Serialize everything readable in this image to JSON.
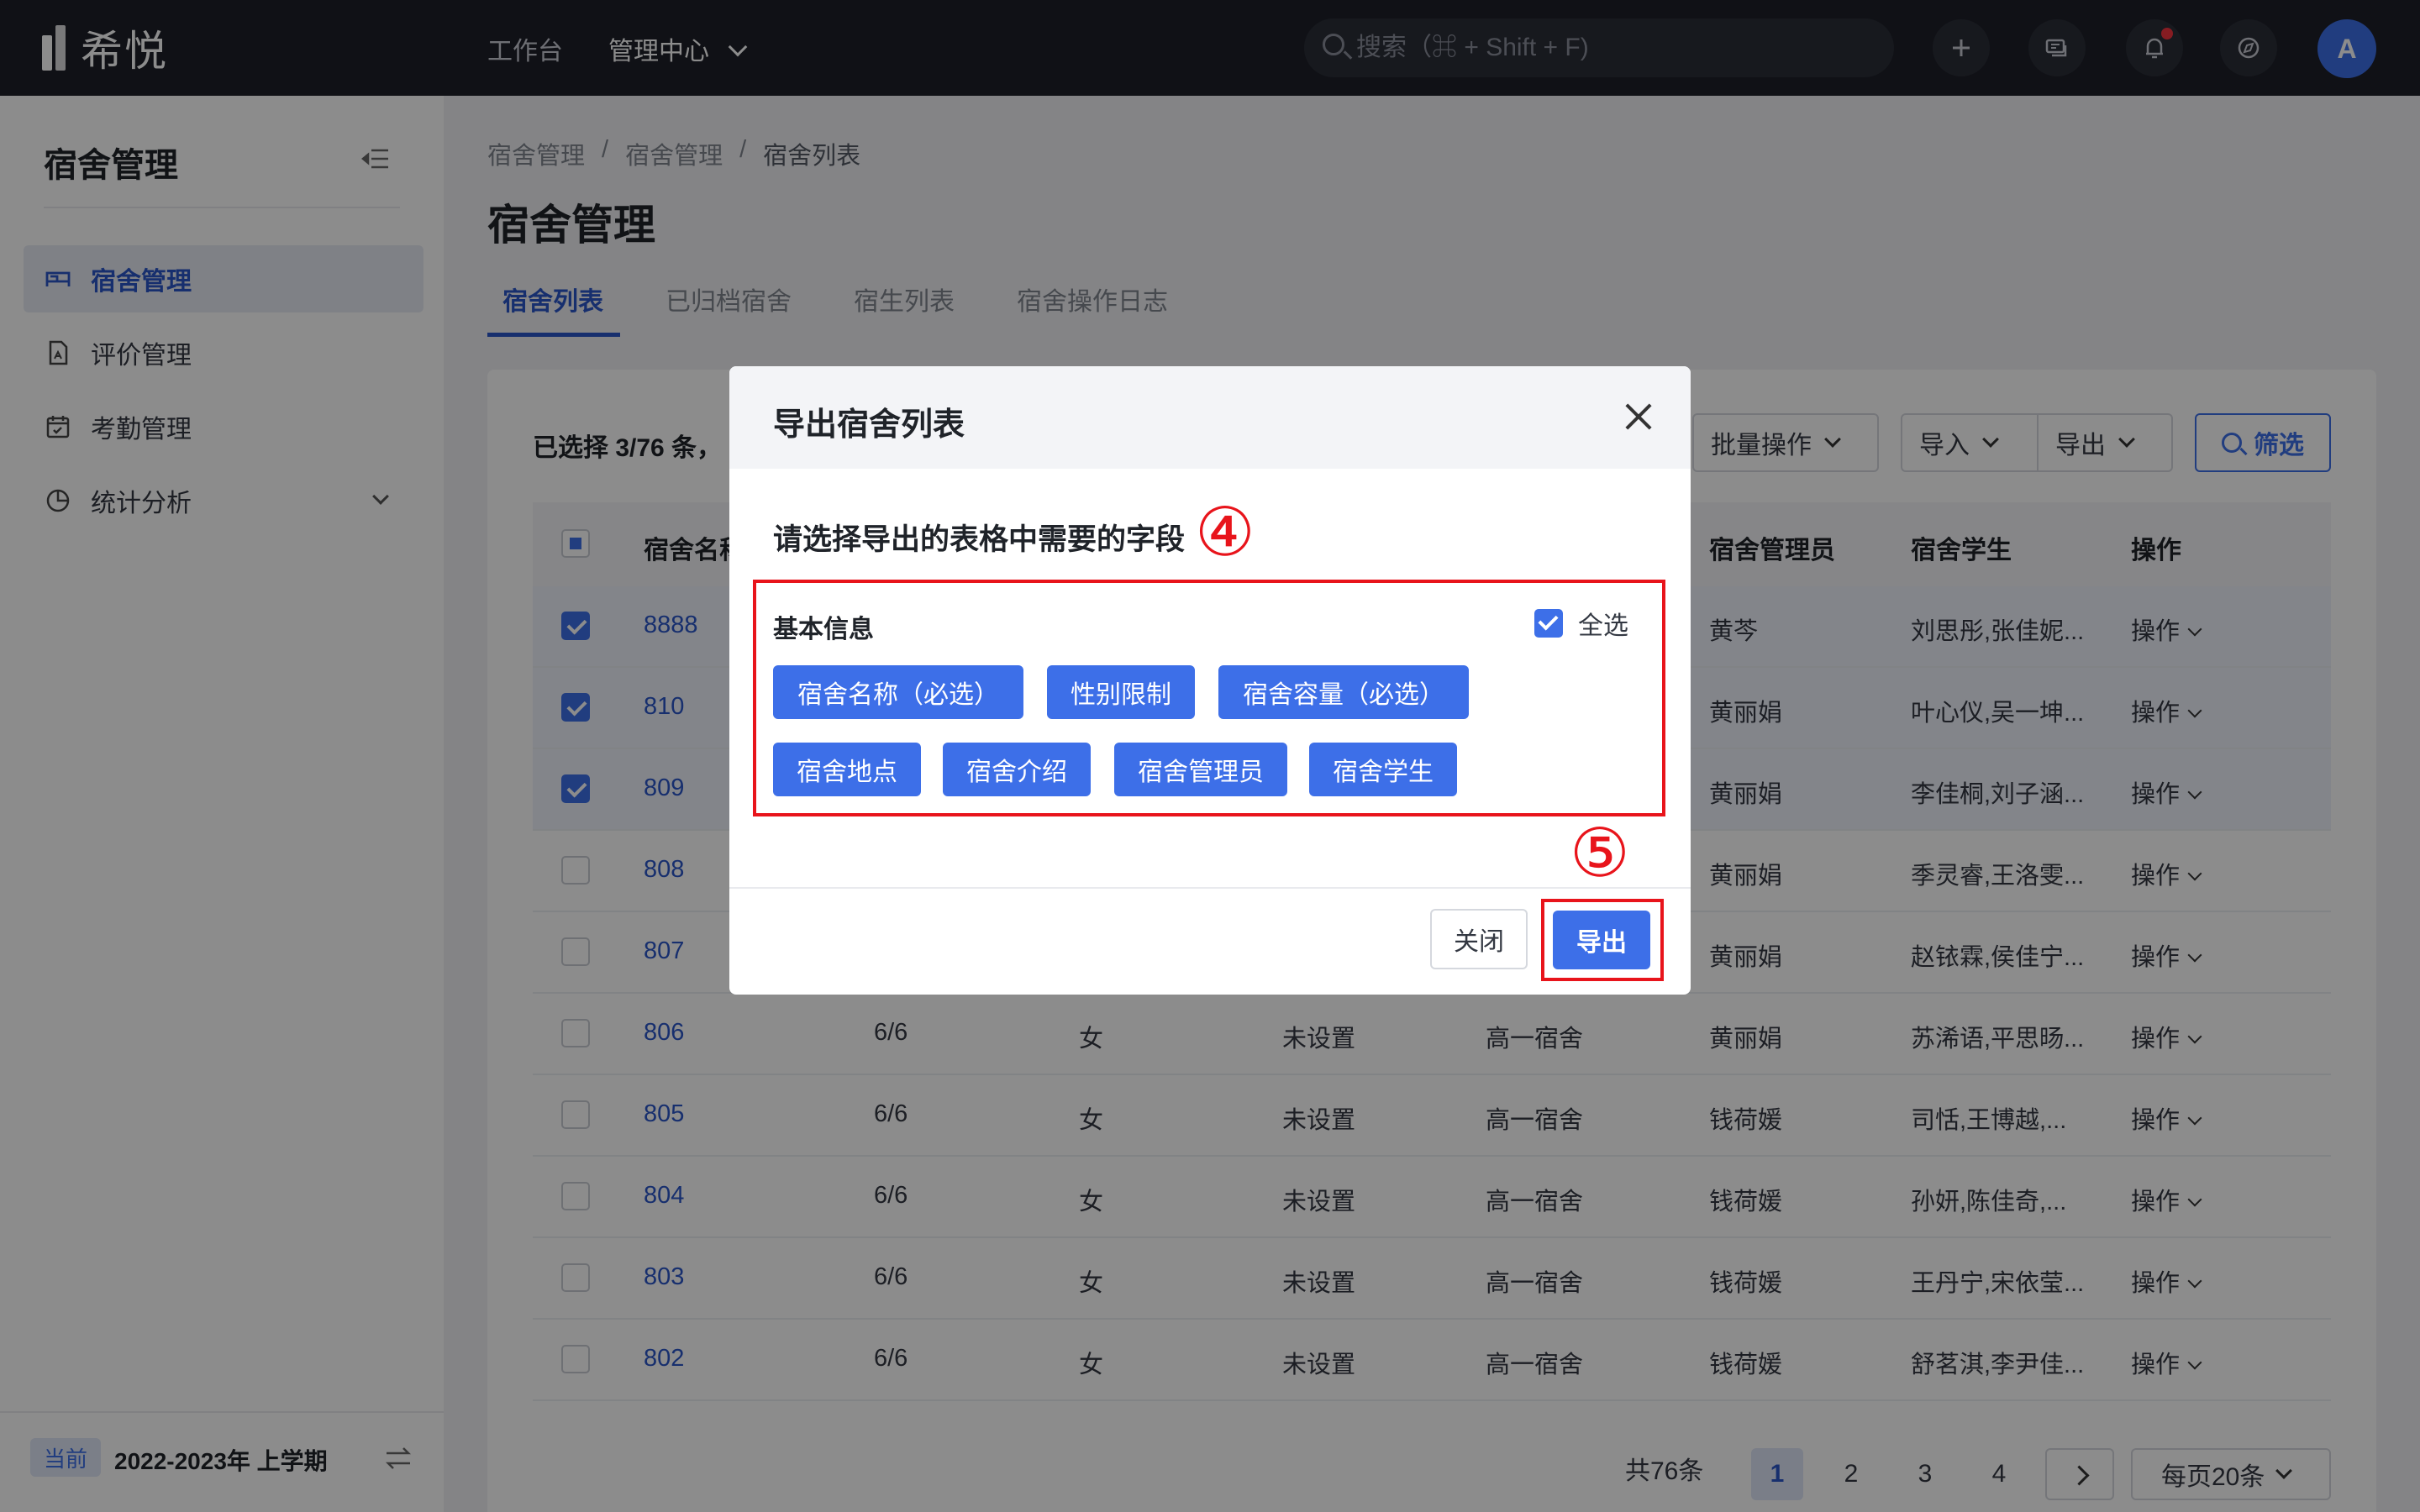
{
  "app": {
    "logo_text": "希悦"
  },
  "topnav": {
    "items": [
      "工作台",
      "管理中心"
    ]
  },
  "search": {
    "placeholder": "搜索（⌘ + Shift + F)"
  },
  "user": {
    "avatar_letter": "A"
  },
  "sidebar": {
    "title": "宿舍管理",
    "items": [
      {
        "label": "宿舍管理",
        "icon": "bed-icon",
        "active": true
      },
      {
        "label": "评价管理",
        "icon": "document-icon",
        "active": false
      },
      {
        "label": "考勤管理",
        "icon": "calendar-icon",
        "active": false
      },
      {
        "label": "统计分析",
        "icon": "pie-chart-icon",
        "active": false
      }
    ],
    "term_badge": "当前",
    "term_text": "2022-2023年 上学期"
  },
  "breadcrumb": [
    "宿舍管理",
    "/",
    "宿舍管理",
    "/",
    "宿舍列表"
  ],
  "page_title": "宿舍管理",
  "tabs": [
    "宿舍列表",
    "已归档宿舍",
    "宿生列表",
    "宿舍操作日志"
  ],
  "toolbar": {
    "selected_info": "已选择 3/76 条，",
    "batch": "批量操作",
    "import": "导入",
    "export": "导出",
    "filter": "筛选"
  },
  "table": {
    "headers": [
      "宿舍名称",
      "宿舍管理员",
      "宿舍学生",
      "操作"
    ],
    "rows": [
      {
        "checked": true,
        "name": "8888",
        "cap": "",
        "gender": "",
        "place": "",
        "building": "",
        "manager": "黄芩",
        "students": "刘思彤,张佳妮...",
        "ops": "操作"
      },
      {
        "checked": true,
        "name": "810",
        "cap": "",
        "gender": "",
        "place": "",
        "building": "",
        "manager": "黄丽娟",
        "students": "叶心仪,吴一坤...",
        "ops": "操作"
      },
      {
        "checked": true,
        "name": "809",
        "cap": "",
        "gender": "",
        "place": "",
        "building": "",
        "manager": "黄丽娟",
        "students": "李佳桐,刘子涵...",
        "ops": "操作"
      },
      {
        "checked": false,
        "name": "808",
        "cap": "",
        "gender": "",
        "place": "",
        "building": "",
        "manager": "黄丽娟",
        "students": "季灵睿,王洛雯...",
        "ops": "操作"
      },
      {
        "checked": false,
        "name": "807",
        "cap": "",
        "gender": "",
        "place": "",
        "building": "",
        "manager": "黄丽娟",
        "students": "赵铱霖,侯佳宁...",
        "ops": "操作"
      },
      {
        "checked": false,
        "name": "806",
        "cap": "6/6",
        "gender": "女",
        "place": "未设置",
        "building": "高一宿舍",
        "manager": "黄丽娟",
        "students": "苏浠语,平思旸...",
        "ops": "操作"
      },
      {
        "checked": false,
        "name": "805",
        "cap": "6/6",
        "gender": "女",
        "place": "未设置",
        "building": "高一宿舍",
        "manager": "钱荷媛",
        "students": "司恬,王博越,...",
        "ops": "操作"
      },
      {
        "checked": false,
        "name": "804",
        "cap": "6/6",
        "gender": "女",
        "place": "未设置",
        "building": "高一宿舍",
        "manager": "钱荷媛",
        "students": "孙妍,陈佳奇,...",
        "ops": "操作"
      },
      {
        "checked": false,
        "name": "803",
        "cap": "6/6",
        "gender": "女",
        "place": "未设置",
        "building": "高一宿舍",
        "manager": "钱荷媛",
        "students": "王丹宁,宋依莹...",
        "ops": "操作"
      },
      {
        "checked": false,
        "name": "802",
        "cap": "6/6",
        "gender": "女",
        "place": "未设置",
        "building": "高一宿舍",
        "manager": "钱荷媛",
        "students": "舒茗淇,李尹佳...",
        "ops": "操作"
      }
    ]
  },
  "pagination": {
    "total": "共76条",
    "pages": [
      "1",
      "2",
      "3",
      "4"
    ],
    "current": "1",
    "page_size": "每页20条"
  },
  "modal": {
    "title": "导出宿舍列表",
    "subtitle": "请选择导出的表格中需要的字段",
    "step_a": "④",
    "step_b": "⑤",
    "group_title": "基本信息",
    "select_all": "全选",
    "fields": [
      "宿舍名称（必选）",
      "性别限制",
      "宿舍容量（必选）",
      "宿舍地点",
      "宿舍介绍",
      "宿舍管理员",
      "宿舍学生"
    ],
    "close_label": "关闭",
    "export_label": "导出"
  },
  "colors": {
    "accent": "#3d6fe8",
    "annotation": "#e8141b",
    "topbar": "#1e2029"
  }
}
